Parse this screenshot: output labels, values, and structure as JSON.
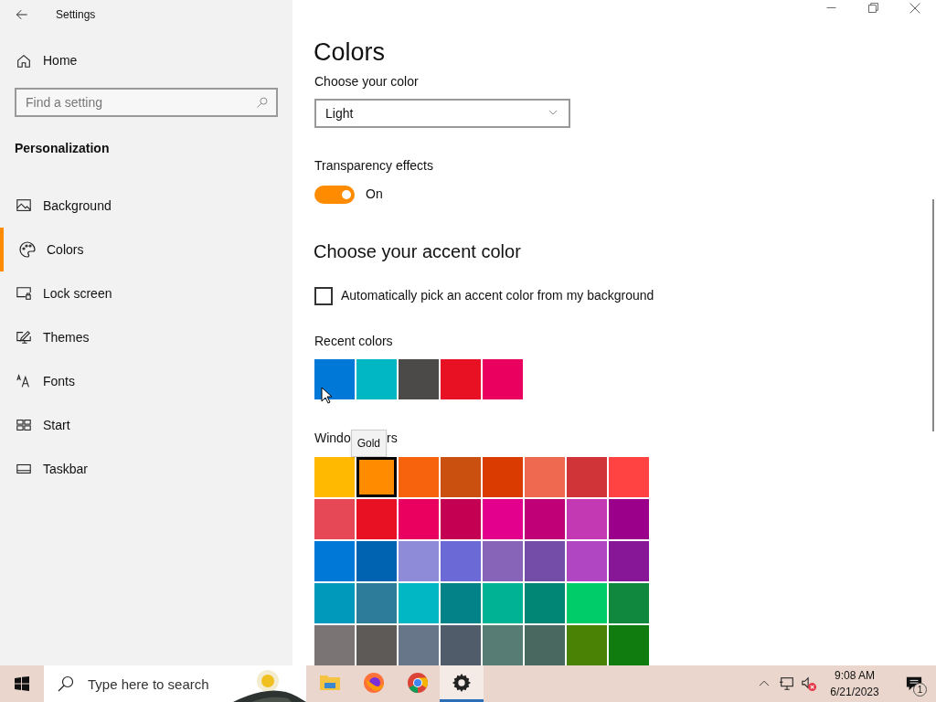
{
  "window": {
    "title": "Settings"
  },
  "sidebar": {
    "home": "Home",
    "search": {
      "placeholder": "Find a setting"
    },
    "section": "Personalization",
    "items": [
      {
        "label": "Background",
        "selected": false
      },
      {
        "label": "Colors",
        "selected": true
      },
      {
        "label": "Lock screen",
        "selected": false
      },
      {
        "label": "Themes",
        "selected": false
      },
      {
        "label": "Fonts",
        "selected": false
      },
      {
        "label": "Start",
        "selected": false
      },
      {
        "label": "Taskbar",
        "selected": false
      }
    ]
  },
  "main": {
    "title": "Colors",
    "choose_color": {
      "label": "Choose your color",
      "value": "Light"
    },
    "transparency": {
      "label": "Transparency effects",
      "on": true,
      "state_text": "On"
    },
    "accent_heading": "Choose your accent color",
    "auto_pick": {
      "label": "Automatically pick an accent color from my background",
      "checked": false
    },
    "recent": {
      "label": "Recent colors",
      "swatches": [
        {
          "color": "#0078d7"
        },
        {
          "color": "#00b7c3"
        },
        {
          "color": "#4c4a48"
        },
        {
          "color": "#e81123"
        },
        {
          "color": "#ea005e"
        }
      ]
    },
    "windows_colors": {
      "heading_before": "Windo",
      "heading_after": "rs",
      "tooltip": "Gold",
      "swatches": [
        {
          "color": "#ffb900",
          "selected": false
        },
        {
          "color": "#ff8c00",
          "selected": true
        },
        {
          "color": "#f7630c",
          "selected": false
        },
        {
          "color": "#ca5010",
          "selected": false
        },
        {
          "color": "#da3b01",
          "selected": false
        },
        {
          "color": "#ef6950",
          "selected": false
        },
        {
          "color": "#d13438",
          "selected": false
        },
        {
          "color": "#ff4343",
          "selected": false
        },
        {
          "color": "#e74856",
          "selected": false
        },
        {
          "color": "#e81123",
          "selected": false
        },
        {
          "color": "#ea005e",
          "selected": false
        },
        {
          "color": "#c30052",
          "selected": false
        },
        {
          "color": "#e3008c",
          "selected": false
        },
        {
          "color": "#bf0077",
          "selected": false
        },
        {
          "color": "#c239b3",
          "selected": false
        },
        {
          "color": "#9a0089",
          "selected": false
        },
        {
          "color": "#0078d7",
          "selected": false
        },
        {
          "color": "#0063b1",
          "selected": false
        },
        {
          "color": "#8e8cd8",
          "selected": false
        },
        {
          "color": "#6b69d6",
          "selected": false
        },
        {
          "color": "#8764b8",
          "selected": false
        },
        {
          "color": "#744da9",
          "selected": false
        },
        {
          "color": "#b146c2",
          "selected": false
        },
        {
          "color": "#881798",
          "selected": false
        },
        {
          "color": "#0099bc",
          "selected": false
        },
        {
          "color": "#2d7d9a",
          "selected": false
        },
        {
          "color": "#00b7c3",
          "selected": false
        },
        {
          "color": "#038387",
          "selected": false
        },
        {
          "color": "#00b294",
          "selected": false
        },
        {
          "color": "#018574",
          "selected": false
        },
        {
          "color": "#00cc6a",
          "selected": false
        },
        {
          "color": "#10893e",
          "selected": false
        },
        {
          "color": "#7a7574",
          "selected": false
        },
        {
          "color": "#5d5a58",
          "selected": false
        },
        {
          "color": "#68768a",
          "selected": false
        },
        {
          "color": "#515c6b",
          "selected": false
        },
        {
          "color": "#567c73",
          "selected": false
        },
        {
          "color": "#486860",
          "selected": false
        },
        {
          "color": "#498205",
          "selected": false
        },
        {
          "color": "#107c10",
          "selected": false
        }
      ]
    }
  },
  "taskbar": {
    "search": {
      "placeholder": "Type here to search"
    },
    "apps": [
      {
        "selected": false
      },
      {
        "selected": false
      },
      {
        "selected": false
      },
      {
        "selected": true
      }
    ],
    "time": "9:08 AM",
    "date": "6/21/2023",
    "notification_count": "1"
  }
}
